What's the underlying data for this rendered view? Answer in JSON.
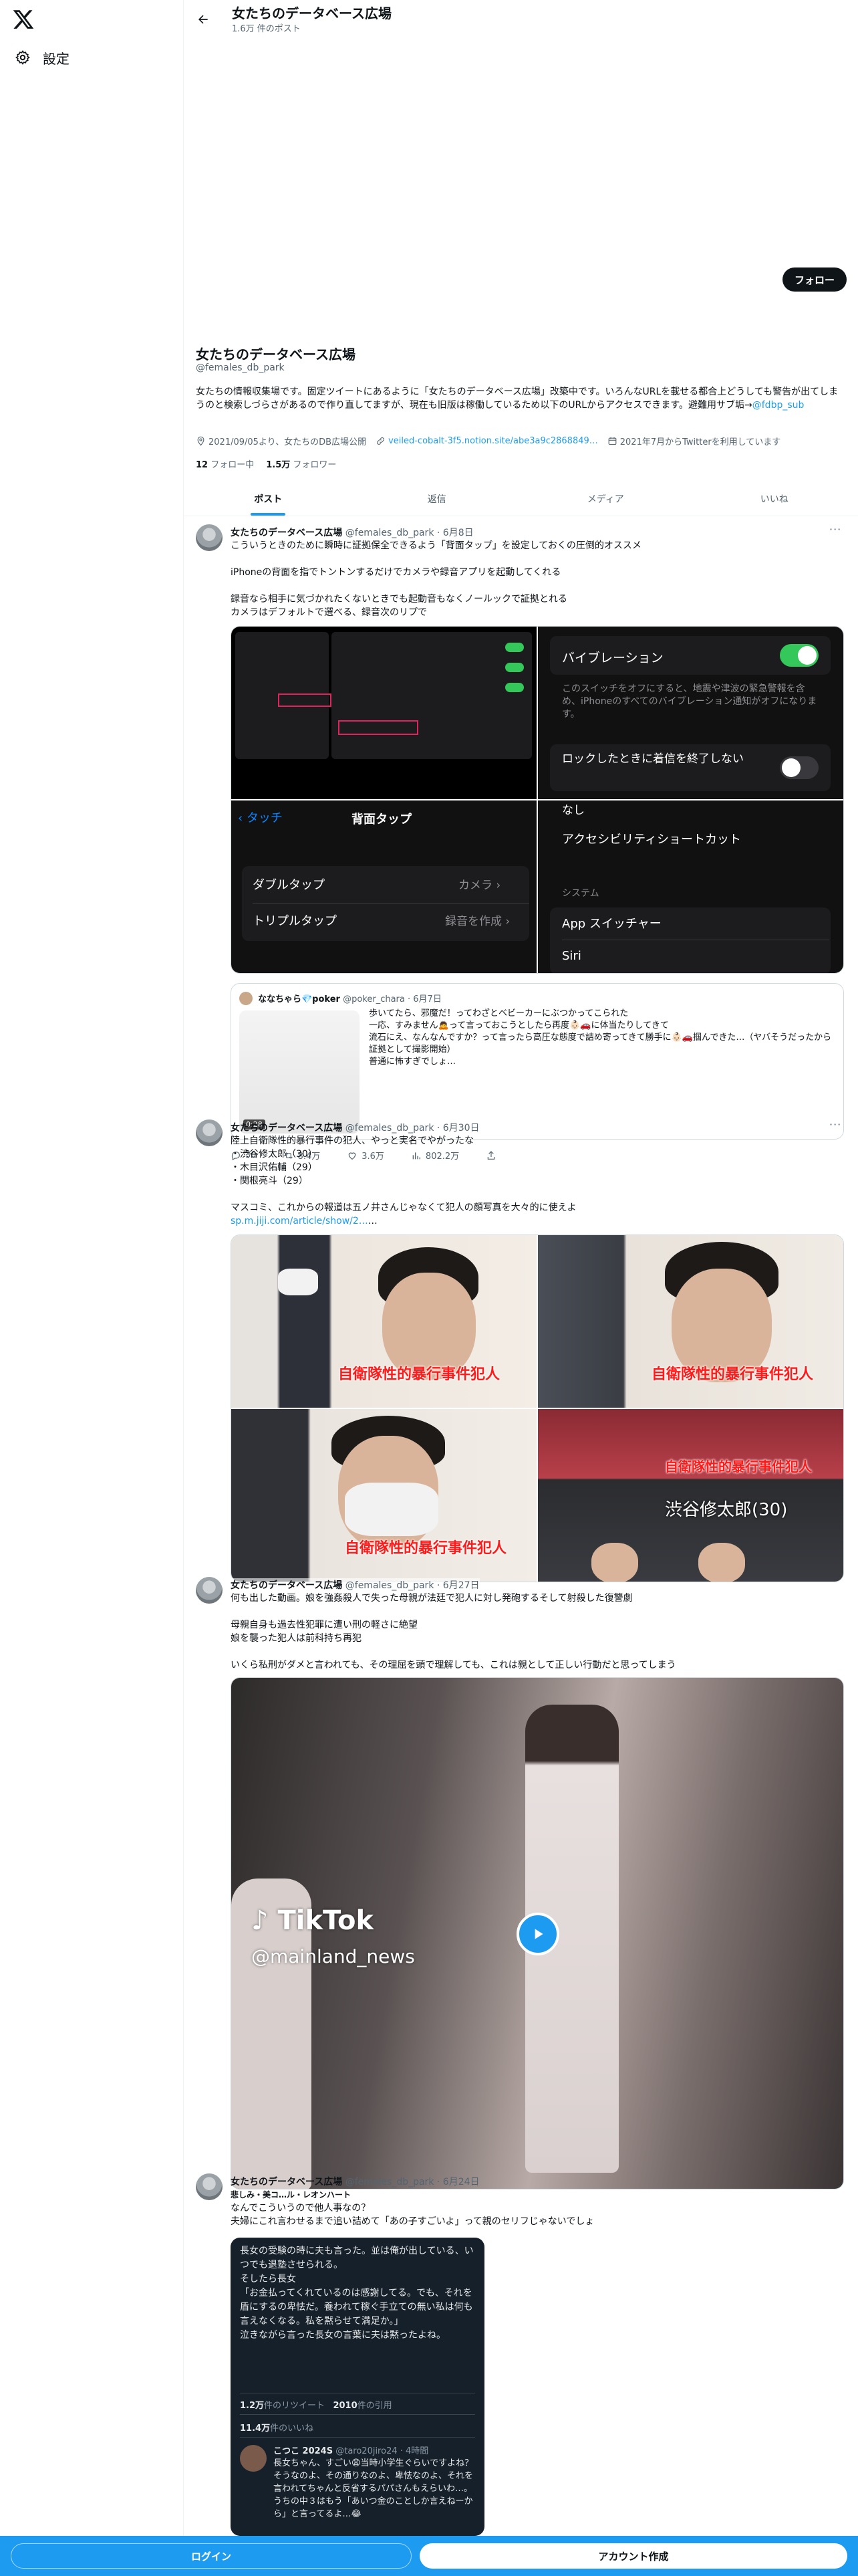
{
  "sidebar": {
    "settings_label": "設定"
  },
  "header": {
    "title": "女たちのデータベース広場",
    "post_count": "1.6万 件のポスト"
  },
  "profile": {
    "follow_label": "フォロー",
    "name": "女たちのデータベース広場",
    "handle": "@females_db_park",
    "bio": "女たちの情報収集場です。固定ツイートにあるように「女たちのデータベース広場」改築中です。いろんなURLを載せる都合上どうしても警告が出てしまうのと検索しづらさがあるので作り直してますが、現在も旧版は稼働しているため以下のURLからアクセスできます。避難用サブ垢→",
    "bio_link": "@fdbp_sub",
    "meta_joined_site": "2021/09/05より、女たちのDB広場公開",
    "meta_url": "veiled-cobalt-3f5.notion.site/abe3a9c2868849…",
    "meta_twitter_since": "2021年7月からTwitterを利用しています",
    "following_count": "12",
    "following_label": "フォロー中",
    "followers_count": "1.5万",
    "followers_label": "フォロワー"
  },
  "tabs": [
    "ポスト",
    "返信",
    "メディア",
    "いいね"
  ],
  "tweet1": {
    "name": "女たちのデータベース広場",
    "handle": "@females_db_park",
    "date": "· 6月8日",
    "text": "こういうときのために瞬時に証拠保全できるよう「背面タップ」を設定しておくの圧倒的オススメ\n\niPhoneの背面を指でトントンするだけでカメラや録音アプリを起動してくれる\n\n録音なら相手に気づかれたくないときでも起動音もなくノールックで証拠とれる\nカメラはデフォルトで選べる、録音次のリプで",
    "screen_vibration": "バイブレーション",
    "screen_vibration_desc": "このスイッチをオフにすると、地震や津波の緊急警報を含め、iPhoneのすべてのバイブレーション通知がオフになります。",
    "screen_lock_end": "ロックしたときに着信を終了しない",
    "screen_back": "タッチ",
    "screen_backtap": "背面タップ",
    "screen_double": "ダブルタップ",
    "screen_double_val": "カメラ",
    "screen_triple": "トリプルタップ",
    "screen_triple_val": "録音を作成",
    "screen_none": "なし",
    "screen_a11y": "アクセシビリティショートカット",
    "screen_system": "システム",
    "screen_appswitch": "App スイッチャー",
    "screen_siri": "Siri"
  },
  "quote": {
    "name": "ななちゃら💎poker",
    "handle": "@poker_chara",
    "date": "· 6月7日",
    "text": "歩いてたら、邪魔だ！ってわざとベビーカーにぶつかってこられた\n一応、すみません🙇って言っておこうとしたら再度👶🏻🚗に体当たりしてきて\n流石にえ、なんなんですか？って言ったら高圧な態度で詰め寄ってきて勝手に👶🏻🚗掴んできた…（ヤバそうだったから証拠として撮影開始）\n普通に怖すぎでしょ…",
    "video_time": "0:28"
  },
  "actions1": {
    "replies": "30",
    "retweets": "8.4万",
    "likes": "3.6万",
    "views": "802.2万"
  },
  "tweet2": {
    "name": "女たちのデータベース広場",
    "handle": "@females_db_park",
    "date": "· 6月30日",
    "text": "陸上自衛隊性的暴行事件の犯人、やっと実名でやがったな\n・渋谷修太郎（30）\n・木目沢佑輔（29）\n・関根亮斗（29）\n\nマスコミ、これからの報道は五ノ井さんじゃなくて犯人の顔写真を大々的に使えよ",
    "link": "sp.m.jiji.com/article/show/2…",
    "caption1": "自衛隊性的暴行事件犯人",
    "caption2": "自衛隊性的暴行事件犯人",
    "caption3": "自衛隊性的暴行事件犯人",
    "caption4a": "自衛隊性的暴行事件犯人",
    "caption4b": "渋谷修太郎(30)"
  },
  "tweet3": {
    "name": "女たちのデータベース広場",
    "handle": "@females_db_park",
    "date": "· 6月27日",
    "text": "何も出した動画。娘を強姦殺人で失った母親が法廷で犯人に対し発砲するそして射殺した復讐劇\n\n母親自身も過去性犯罪に遭い刑の軽さに絶望\n娘を襲った犯人は前科持ち再犯\n\nいくら私刑がダメと言われても、その理屈を頭で理解しても、これは親として正しい行動だと思ってしまう",
    "tiktok_logo": "TikTok",
    "tiktok_handle": "@mainland_news"
  },
  "tweet4": {
    "name": "女たちのデータベース広場",
    "handle": "@females_db_park",
    "date": "· 6月24日",
    "quote_line": "悲しみ・美コ…ル・レオンハート",
    "text": "なんでこういうので他人事なの？\n夫婦にこれ言わせるまで追い詰めて「あの子すごいよ」って親のセリフじゃないでしょ",
    "shot_text": "長女の受験の時に夫も言った。並は俺が出している、いつでも退塾させられる。\nそしたら長女\n「お金払ってくれているのは感謝してる。でも、それを盾にするの卑怯だ。養われて稼ぐ手立ての無い私は何も言えなくなる。私を黙らせて満足か。」\n泣きながら言った長女の言葉に夫は黙ったよね。",
    "shot_retweets": "1.2万",
    "shot_retweets_label": "件のリツイート",
    "shot_quotes": "2010",
    "shot_quotes_label": "件の引用",
    "shot_likes": "11.4万",
    "shot_likes_label": "件のいいね",
    "reply_name": "こつこ 2024S",
    "reply_handle": "@taro20jiro24 · 4時間",
    "reply_text": "長女ちゃん、すごい😩当時小学生ぐらいですよね？そうなのよ、その通りなのよ、卑怯なのよ、それを言われてちゃんと反省するパパさんもえらいわ…。\nうちの中３はもう「あいつ金のことしか言えねーから」と言ってるよ…😂"
  },
  "bottom": {
    "login": "ログイン",
    "signup": "アカウント作成"
  },
  "colors": {
    "accent": "#1d9bf0",
    "text": "#0f1419",
    "muted": "#536471"
  }
}
